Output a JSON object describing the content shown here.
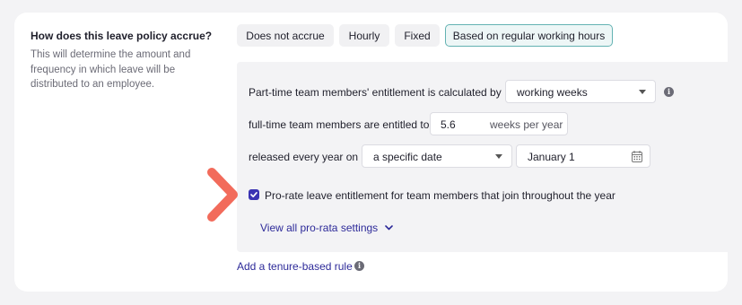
{
  "question": {
    "title": "How does this leave policy accrue?",
    "description": "This will determine the amount and frequency in which leave will be distributed to an employee."
  },
  "accrual_options": {
    "items": [
      "Does not accrue",
      "Hourly",
      "Fixed",
      "Based on regular working hours"
    ],
    "selected": "Based on regular working hours"
  },
  "panel": {
    "parttime_label": "Part-time team members' entitlement is calculated by",
    "parttime_select": "working weeks",
    "fulltime_label": "full-time team members are entitled to",
    "fulltime_value": "5.6",
    "fulltime_unit": "weeks per year",
    "released_label": "released every year on",
    "released_select": "a specific date",
    "release_date": "January 1",
    "prorate_label": "Pro-rate leave entitlement for team members that join throughout the year",
    "prorate_checked": true,
    "view_prorata_link": "View all pro-rata settings"
  },
  "tenure_link": "Add a tenure-based rule",
  "colors": {
    "accent": "#3a33b3",
    "active_border": "#63b2b2",
    "arrow": "#f26b5b"
  }
}
